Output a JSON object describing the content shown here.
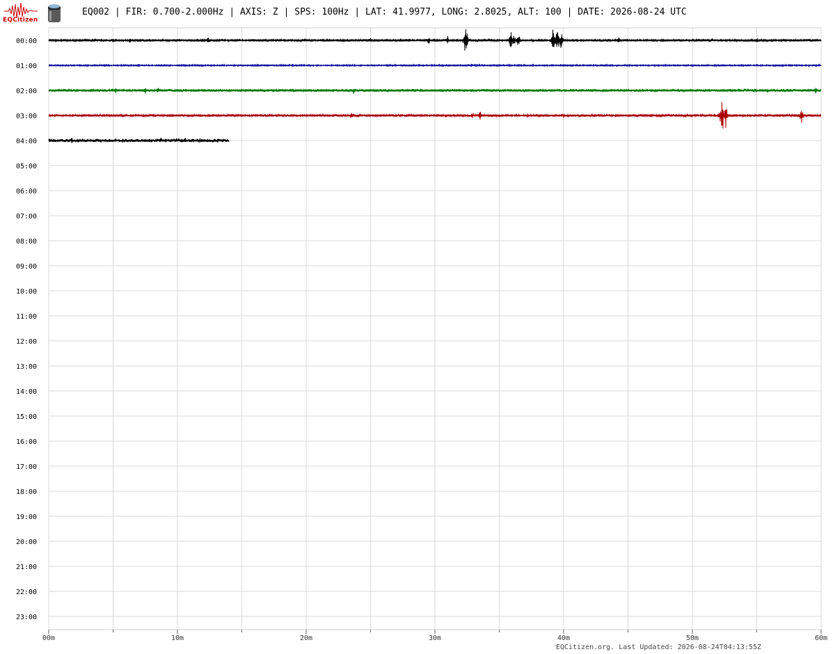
{
  "header": {
    "logo_text": "EQCitizen",
    "title": "EQ002 | FIR: 0.700-2.000Hz | AXIS: Z | SPS: 100Hz | LAT: 41.9977, LONG: 2.8025, ALT: 100 | DATE: 2026-08-24 UTC"
  },
  "footer": {
    "site": "EQCitizen.org.",
    "updated_label": "Last Updated:",
    "updated_value": "2026-08-24T04:13:55Z"
  },
  "chart_data": {
    "type": "line",
    "title": "",
    "xlabel": "",
    "ylabel": "",
    "x_unit": "minutes",
    "xlim": [
      0,
      60
    ],
    "x_ticks": [
      "00m",
      "10m",
      "20m",
      "30m",
      "40m",
      "50m",
      "60m"
    ],
    "x_minor_ticks": [
      5,
      15,
      25,
      35,
      45,
      55
    ],
    "grid": true,
    "rows": [
      "00:00",
      "01:00",
      "02:00",
      "03:00",
      "04:00",
      "05:00",
      "06:00",
      "07:00",
      "08:00",
      "09:00",
      "10:00",
      "11:00",
      "12:00",
      "13:00",
      "14:00",
      "15:00",
      "16:00",
      "17:00",
      "18:00",
      "19:00",
      "20:00",
      "21:00",
      "22:00",
      "23:00"
    ],
    "colors": {
      "row0": "#000000",
      "row1": "#000099",
      "row2": "#007700",
      "row3": "#aa0000",
      "row4": "#000000",
      "grid": "#d9d9d9"
    },
    "series": [
      {
        "row": 0,
        "color": "#000000",
        "end_minute": 60,
        "noise": 1.5,
        "bursts": [
          {
            "t": 1.2,
            "amp": 3
          },
          {
            "t": 5.0,
            "amp": 5
          },
          {
            "t": 6.3,
            "amp": 6
          },
          {
            "t": 9.8,
            "amp": 3
          },
          {
            "t": 12.4,
            "amp": 7
          },
          {
            "t": 25.0,
            "amp": 6
          },
          {
            "t": 29.5,
            "amp": 8
          },
          {
            "t": 31.0,
            "amp": 9
          },
          {
            "t": 32.4,
            "amp": 32
          },
          {
            "t": 35.9,
            "amp": 18
          },
          {
            "t": 36.1,
            "amp": 16
          },
          {
            "t": 36.5,
            "amp": 14
          },
          {
            "t": 39.2,
            "amp": 26
          },
          {
            "t": 39.5,
            "amp": 28
          },
          {
            "t": 39.8,
            "amp": 20
          },
          {
            "t": 44.3,
            "amp": 9
          },
          {
            "t": 47.0,
            "amp": 4
          },
          {
            "t": 51.5,
            "amp": 4
          },
          {
            "t": 55.0,
            "amp": 6
          }
        ]
      },
      {
        "row": 1,
        "color": "#000099",
        "end_minute": 60,
        "noise": 1.0,
        "bursts": [
          {
            "t": 7.0,
            "amp": 4
          },
          {
            "t": 18.0,
            "amp": 2
          },
          {
            "t": 28.8,
            "amp": 2
          },
          {
            "t": 38.5,
            "amp": 2
          },
          {
            "t": 47.3,
            "amp": 2
          },
          {
            "t": 57.0,
            "amp": 2
          }
        ]
      },
      {
        "row": 2,
        "color": "#007700",
        "end_minute": 60,
        "noise": 1.8,
        "bursts": [
          {
            "t": 5.2,
            "amp": 7
          },
          {
            "t": 7.5,
            "amp": 6
          },
          {
            "t": 8.5,
            "amp": 7
          },
          {
            "t": 23.7,
            "amp": 8
          },
          {
            "t": 24.5,
            "amp": 5
          },
          {
            "t": 30.6,
            "amp": 4
          },
          {
            "t": 52.2,
            "amp": 3
          },
          {
            "t": 55.8,
            "amp": 5
          },
          {
            "t": 59.6,
            "amp": 7
          }
        ]
      },
      {
        "row": 3,
        "color": "#aa0000",
        "end_minute": 60,
        "noise": 1.6,
        "bursts": [
          {
            "t": 10.4,
            "amp": 4
          },
          {
            "t": 23.5,
            "amp": 6
          },
          {
            "t": 32.9,
            "amp": 9
          },
          {
            "t": 33.5,
            "amp": 10
          },
          {
            "t": 37.2,
            "amp": 4
          },
          {
            "t": 40.0,
            "amp": 5
          },
          {
            "t": 52.3,
            "amp": 40
          },
          {
            "t": 52.6,
            "amp": 30
          },
          {
            "t": 58.5,
            "amp": 16
          }
        ]
      },
      {
        "row": 4,
        "color": "#000000",
        "end_minute": 14.0,
        "noise": 2.6,
        "bursts": [
          {
            "t": 1.8,
            "amp": 6
          },
          {
            "t": 3.5,
            "amp": 4
          },
          {
            "t": 8.7,
            "amp": 7
          },
          {
            "t": 10.6,
            "amp": 6
          },
          {
            "t": 11.7,
            "amp": 6
          }
        ]
      }
    ]
  }
}
